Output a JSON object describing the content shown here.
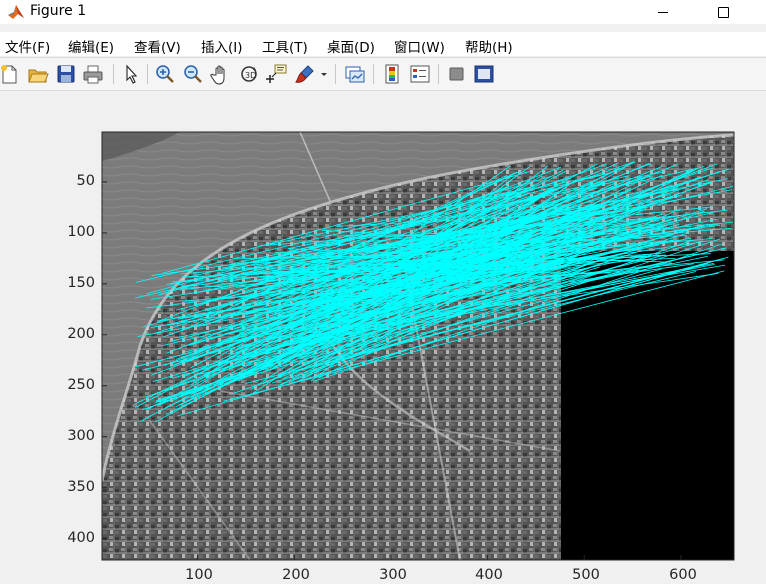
{
  "window": {
    "title": "Figure 1",
    "icon": "matlab-icon"
  },
  "menu": {
    "items": [
      "文件(F)",
      "编辑(E)",
      "查看(V)",
      "插入(I)",
      "工具(T)",
      "桌面(D)",
      "窗口(W)",
      "帮助(H)"
    ]
  },
  "toolbar": {
    "buttons": [
      "new-figure-icon",
      "open-file-icon",
      "save-icon",
      "print-icon",
      "edit-plot-icon",
      "zoom-in-icon",
      "zoom-out-icon",
      "pan-icon",
      "rotate-3d-icon",
      "data-cursor-icon",
      "brush-icon",
      "link-plot-icon",
      "insert-colorbar-icon",
      "insert-legend-icon",
      "hide-plot-tools-icon",
      "show-plot-tools-icon"
    ]
  },
  "colors": {
    "match_lines": "#00ffff",
    "background": "#f0f0f0"
  },
  "chart_data": {
    "type": "image",
    "xlim": [
      1,
      655
    ],
    "ylim": [
      1,
      421
    ],
    "y_direction": "reverse",
    "xticks": [
      100,
      200,
      300,
      400,
      500,
      600
    ],
    "yticks": [
      50,
      100,
      150,
      200,
      250,
      300,
      350,
      400
    ],
    "xtick_labels": [
      "100",
      "200",
      "300",
      "400",
      "500",
      "600"
    ],
    "ytick_labels": [
      "50",
      "100",
      "150",
      "200",
      "250",
      "300",
      "350",
      "400"
    ]
  }
}
